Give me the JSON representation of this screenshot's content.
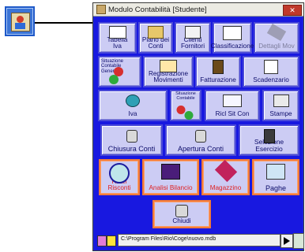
{
  "window": {
    "title": "Modulo Contabilità  [Studente]",
    "close_label": "✕"
  },
  "buttons": {
    "tabella_iva": "Tabella\nIva",
    "piano_conti": "Piano dei\nConti",
    "clienti_fornitori": "Clienti\nFornitori",
    "classificazione": "Classificazione",
    "dettagli_mov": "Dettagli Mov",
    "situazione_contabile_label": "Situazione\nContabile\nGenerale",
    "registrazione_movimenti": "Registrazione\nMovimenti",
    "fatturazione": "Fatturazione",
    "scadenzario": "Scadenzario",
    "iva": "Iva",
    "situazione_contabile_small": "Situazione\nContabile",
    "ricl_sit_con": "Ricl Sit Con",
    "stampe": "Stampe",
    "chiusura_conti": "Chiusura Conti",
    "apertura_conti": "Apertura Conti",
    "selezione_esercizio": "Selezione Esercizio",
    "ratei_risconti": "Ratei Risconti",
    "analisi_bilancio": "Analisi Bilancio",
    "magazzino": "Magazzino",
    "paghe": "Paghe",
    "chiudi": "Chiudi"
  },
  "status": {
    "path_text": "C:\\Program Files\\Rio\\Coge\\nuovo.mdb"
  },
  "colors": {
    "window_bg": "#1818e0",
    "button_bg": "#ccccf4",
    "accent_orange": "#f07a3a"
  }
}
